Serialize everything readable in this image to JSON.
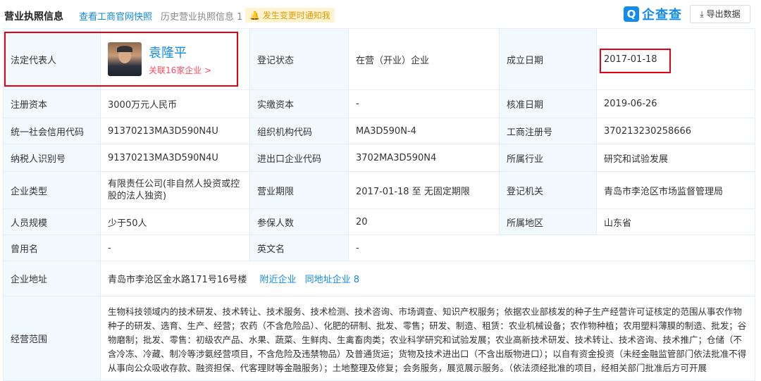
{
  "header": {
    "title": "营业执照信息",
    "link_fast_photo": "查看工商官网快照",
    "history": "历史营业执照信息 1",
    "notify": "发生变更时通知我",
    "logo_text": "企查查",
    "export_label": "导出数据"
  },
  "rows": {
    "legal": {
      "key": "法定代表人",
      "name": "袁隆平",
      "related": "关联16家企业 >"
    },
    "status": {
      "key": "登记状态",
      "value": "在营（开业）企业"
    },
    "founded": {
      "key": "成立日期",
      "value": "2017-01-18"
    },
    "reg_capital": {
      "key": "注册资本",
      "value": "3000万元人民币"
    },
    "paid_capital": {
      "key": "实缴资本",
      "value": "-"
    },
    "approved": {
      "key": "核准日期",
      "value": "2019-06-26"
    },
    "credit_code": {
      "key": "统一社会信用代码",
      "value": "91370213MA3D590N4U"
    },
    "org_code": {
      "key": "组织机构代码",
      "value": "MA3D590N-4"
    },
    "biz_reg_no": {
      "key": "工商注册号",
      "value": "370213230258666"
    },
    "taxpayer_id": {
      "key": "纳税人识别号",
      "value": "91370213MA3D590N4U"
    },
    "import_code": {
      "key": "进出口企业代码",
      "value": "3702MA3D590N4"
    },
    "industry": {
      "key": "所属行业",
      "value": "研究和试验发展"
    },
    "company_type": {
      "key": "企业类型",
      "value": "有限责任公司(非自然人投资或控股的法人独资)"
    },
    "term": {
      "key": "营业期限",
      "value": "2017-01-18 至 无固定期限"
    },
    "authority": {
      "key": "登记机关",
      "value": "青岛市李沧区市场监督管理局"
    },
    "staff": {
      "key": "人员规模",
      "value": "少于50人"
    },
    "insured": {
      "key": "参保人数",
      "value": "20"
    },
    "region": {
      "key": "所属地区",
      "value": "山东省"
    },
    "former_name": {
      "key": "曾用名",
      "value": "-"
    },
    "english_name": {
      "key": "英文名",
      "value": "-"
    },
    "address": {
      "key": "企业地址",
      "value": "青岛市李沧区金水路171号16号楼",
      "nearby": "附近企业",
      "same_addr": "同地址企业 8"
    },
    "scope": {
      "key": "经营范围",
      "value": "生物科技领域内的技术研发、技术转让、技术服务、技术检测、技术咨询、市场调查、知识产权服务；依据农业部核发的种子生产经营许可证核定的范围从事农作物种子的研发、选育、生产、经营；农药（不含危险品）、化肥的研制、批发、零售；研发、制造、租赁：农业机械设备；农作物种植；农用塑料薄膜的制造、批发；谷物磨制；批发、零售：初级农产品、水果、蔬菜、生鲜肉、生禽畜肉类；农业科学研究和试验发展；农业高新技术研发、技术转让、技术咨询、技术推广；仓储（不含冷冻、冷藏、制冷等涉氨经营项目，不含危险及违禁物品）及普通货运；货物及技术进出口（不含出版物进口）；以自有资金投资（未经金融监管部门依法批准不得从事向公众吸收存款、融资担保、代客理财等金融服务）；土地整理及修复；会务服务，展览展示服务。（依法须经批准的项目，经相关部门批准后方可开展"
    }
  },
  "colors": {
    "accent": "#128bed",
    "highlight": "#e60012",
    "key_bg": "#f2f9fc"
  }
}
